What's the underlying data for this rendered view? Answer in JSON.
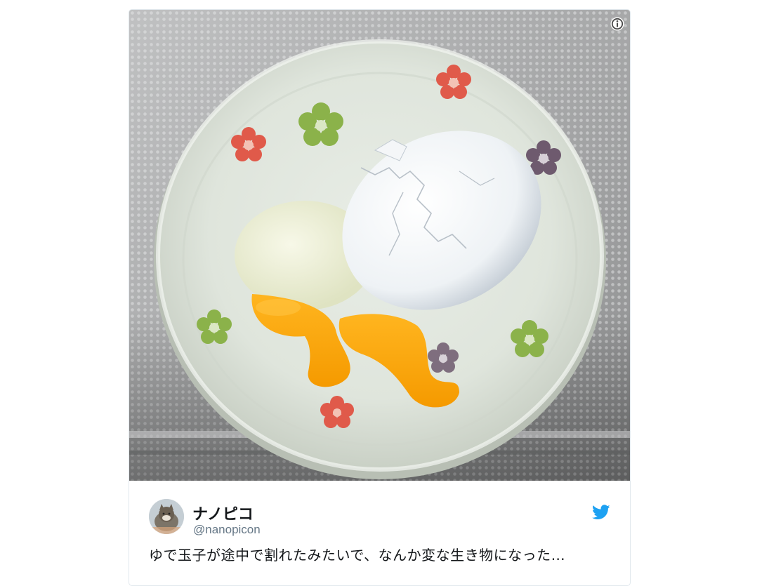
{
  "tweet": {
    "display_name": "ナノピコ",
    "handle": "@nanopicon",
    "text": "ゆで玉子が途中で割れたみたいで、なんか変な生き物になった…"
  },
  "media": {
    "description_icon": "info-icon"
  },
  "icons": {
    "info": "info-icon",
    "brand": "twitter-bird-icon"
  },
  "colors": {
    "twitter_blue": "#1da1f2",
    "text_primary": "#14171a",
    "text_secondary": "#657786",
    "border": "#e1e8ed"
  }
}
